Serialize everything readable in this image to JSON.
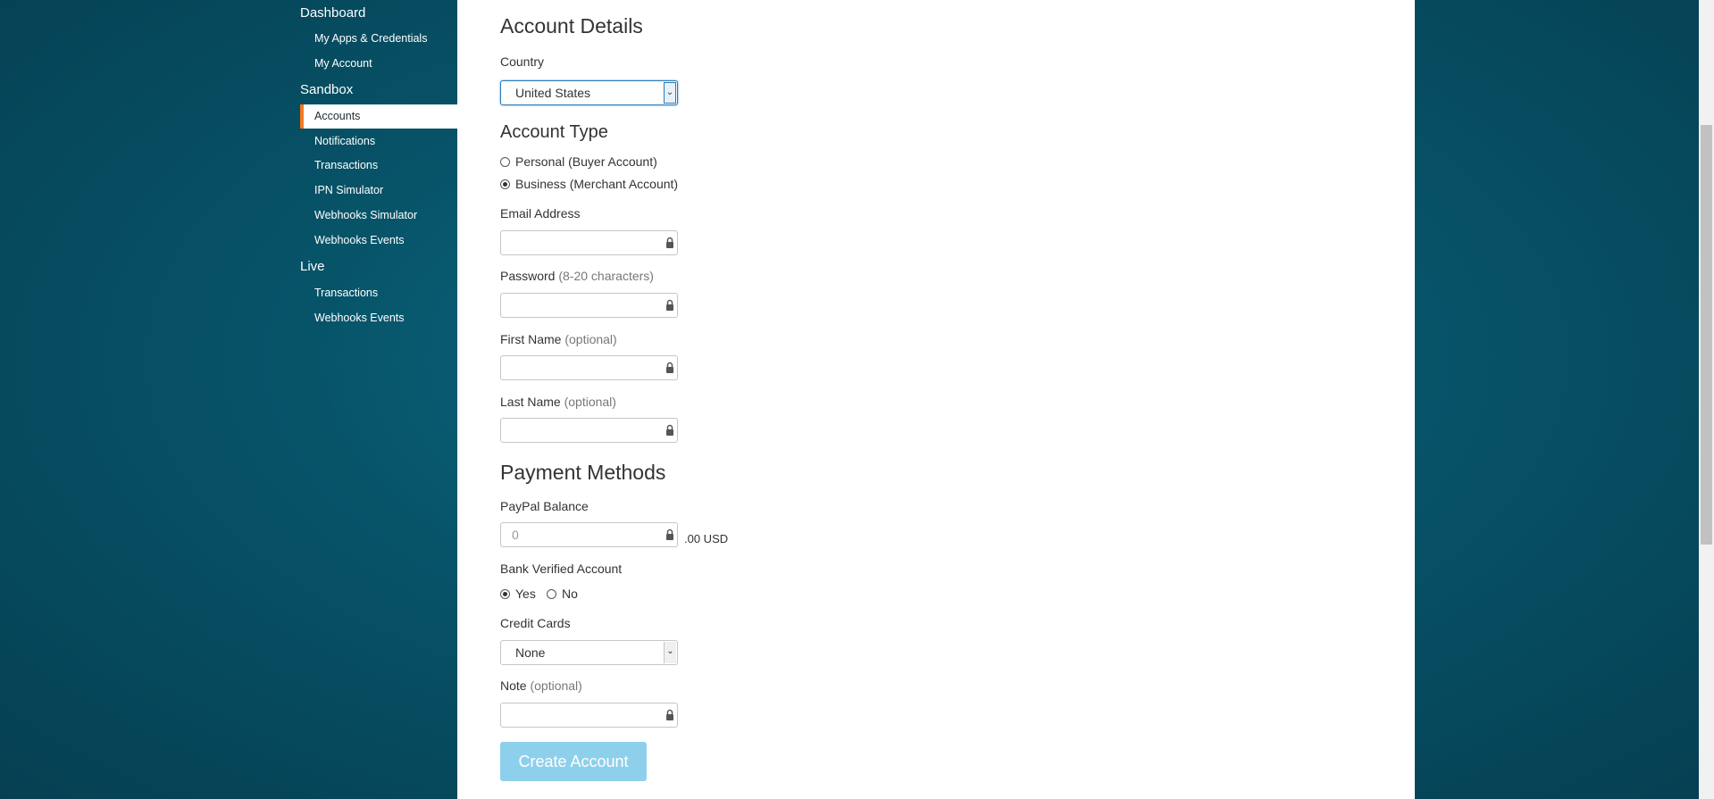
{
  "sidebar": {
    "dashboard": {
      "title": "Dashboard",
      "items": [
        {
          "label": "My Apps & Credentials"
        },
        {
          "label": "My Account"
        }
      ]
    },
    "sandbox": {
      "title": "Sandbox",
      "items": [
        {
          "label": "Accounts",
          "active": true
        },
        {
          "label": "Notifications"
        },
        {
          "label": "Transactions"
        },
        {
          "label": "IPN Simulator"
        },
        {
          "label": "Webhooks Simulator"
        },
        {
          "label": "Webhooks Events"
        }
      ]
    },
    "live": {
      "title": "Live",
      "items": [
        {
          "label": "Transactions"
        },
        {
          "label": "Webhooks Events"
        }
      ]
    }
  },
  "form": {
    "account_details_heading": "Account Details",
    "country": {
      "label": "Country",
      "value": "United States"
    },
    "account_type_heading": "Account Type",
    "account_type_options": [
      {
        "label": "Personal (Buyer Account)",
        "checked": false
      },
      {
        "label": "Business (Merchant Account)",
        "checked": true
      }
    ],
    "email": {
      "label": "Email Address",
      "value": ""
    },
    "password": {
      "label": "Password",
      "hint": "(8-20 characters)",
      "value": ""
    },
    "first_name": {
      "label": "First Name",
      "hint": "(optional)",
      "value": ""
    },
    "last_name": {
      "label": "Last Name",
      "hint": "(optional)",
      "value": ""
    },
    "payment_methods_heading": "Payment Methods",
    "paypal_balance": {
      "label": "PayPal Balance",
      "placeholder": "0",
      "suffix": ".00 USD"
    },
    "bank_verified": {
      "label": "Bank Verified Account",
      "options": [
        {
          "label": "Yes",
          "checked": true
        },
        {
          "label": "No",
          "checked": false
        }
      ]
    },
    "credit_cards": {
      "label": "Credit Cards",
      "value": "None"
    },
    "note": {
      "label": "Note",
      "hint": "(optional)",
      "value": ""
    },
    "submit_label": "Create Account"
  },
  "colors": {
    "accent": "#f47b20",
    "button": "#8ed0ec",
    "background": "#075469"
  }
}
